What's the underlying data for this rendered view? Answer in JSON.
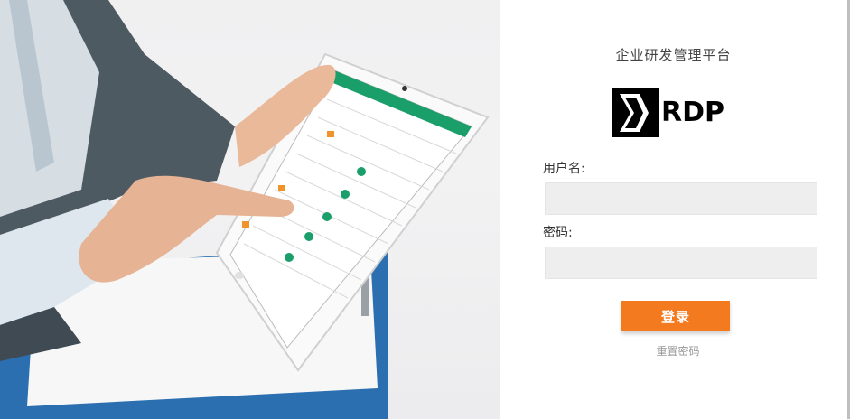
{
  "platform_title": "企业研发管理平台",
  "logo_text": "RDP",
  "form": {
    "username_label": "用户名:",
    "username_value": "",
    "password_label": "密码:",
    "password_value": "",
    "login_button": "登录",
    "reset_link": "重置密码"
  },
  "colors": {
    "login_button": "#f47a1f",
    "input_bg": "#eeeeee",
    "tablet_header": "#1a9e6a"
  }
}
